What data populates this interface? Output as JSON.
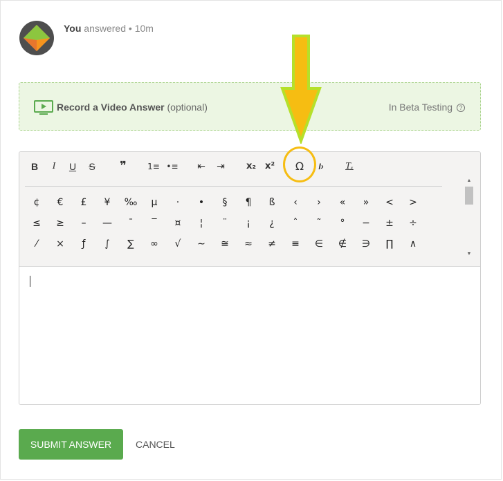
{
  "post": {
    "author": "You",
    "action": "answered",
    "separator": "•",
    "time": "10m"
  },
  "video": {
    "title": "Record a Video Answer",
    "optional": "(optional)",
    "beta": "In Beta Testing",
    "help": "?"
  },
  "toolbar": {
    "bold": "B",
    "italic": "I",
    "underline": "U",
    "strike": "S",
    "quote": "❞",
    "ordered_list": "1≡",
    "bullet_list": "•≡",
    "outdent": "⇤",
    "indent": "⇥",
    "subscript": "x₂",
    "superscript": "x²",
    "special_char": "Ω",
    "code": "I›",
    "clear_format": "Tₓ"
  },
  "special_chars": [
    [
      "¢",
      "€",
      "£",
      "¥",
      "‰",
      "µ",
      "·",
      "•",
      "§",
      "¶",
      "ß",
      "‹",
      "›",
      "«",
      "»",
      "<",
      ">"
    ],
    [
      "≤",
      "≥",
      "–",
      "—",
      "¯",
      "‾",
      "¤",
      "¦",
      "¨",
      "¡",
      "¿",
      "ˆ",
      "˜",
      "°",
      "−",
      "±",
      "÷"
    ],
    [
      "⁄",
      "×",
      "ƒ",
      "∫",
      "∑",
      "∞",
      "√",
      "∼",
      "≅",
      "≈",
      "≠",
      "≡",
      "∈",
      "∉",
      "∋",
      "∏",
      "∧"
    ]
  ],
  "buttons": {
    "submit": "SUBMIT ANSWER",
    "cancel": "CANCEL"
  },
  "colors": {
    "accent_green": "#5aaa4e",
    "beta_bg": "#ecf6e3",
    "annotation_yellow": "#f6bd12",
    "annotation_outline": "#b5e02b"
  }
}
